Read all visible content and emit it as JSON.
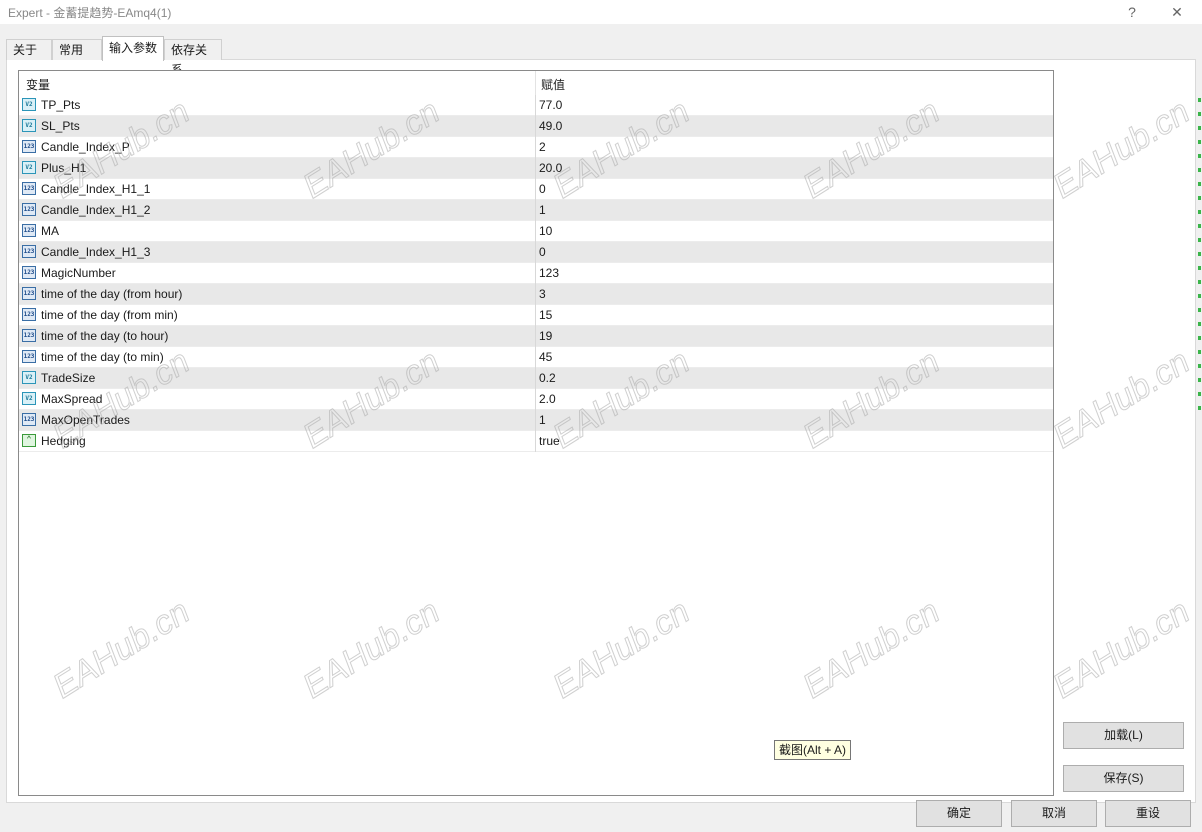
{
  "window": {
    "title": "Expert - 金蓄提趋势-EAmq4(1)",
    "help_label": "?",
    "close_label": "✕"
  },
  "tabs": [
    {
      "label": "关于",
      "active": false
    },
    {
      "label": "常用",
      "active": false
    },
    {
      "label": "输入参数",
      "active": true
    },
    {
      "label": "依存关系",
      "active": false
    }
  ],
  "table": {
    "header": {
      "variable": "变量",
      "value": "赋值"
    },
    "rows": [
      {
        "type": "double",
        "icon": "v2-icon",
        "name": "TP_Pts",
        "value": "77.0"
      },
      {
        "type": "double",
        "icon": "v2-icon",
        "name": "SL_Pts",
        "value": "49.0"
      },
      {
        "type": "int",
        "icon": "123-icon",
        "name": "Candle_Index_P",
        "value": "2"
      },
      {
        "type": "double",
        "icon": "v2-icon",
        "name": "Plus_H1",
        "value": "20.0"
      },
      {
        "type": "int",
        "icon": "123-icon",
        "name": "Candle_Index_H1_1",
        "value": "0"
      },
      {
        "type": "int",
        "icon": "123-icon",
        "name": "Candle_Index_H1_2",
        "value": "1"
      },
      {
        "type": "int",
        "icon": "123-icon",
        "name": "MA",
        "value": "10"
      },
      {
        "type": "int",
        "icon": "123-icon",
        "name": "Candle_Index_H1_3",
        "value": "0"
      },
      {
        "type": "int",
        "icon": "123-icon",
        "name": "MagicNumber",
        "value": "123"
      },
      {
        "type": "int",
        "icon": "123-icon",
        "name": "time of the day (from hour)",
        "value": "3"
      },
      {
        "type": "int",
        "icon": "123-icon",
        "name": "time of the day (from min)",
        "value": "15"
      },
      {
        "type": "int",
        "icon": "123-icon",
        "name": "time of the day (to hour)",
        "value": "19"
      },
      {
        "type": "int",
        "icon": "123-icon",
        "name": "time of the day (to min)",
        "value": "45"
      },
      {
        "type": "double",
        "icon": "v2-icon",
        "name": "TradeSize",
        "value": "0.2"
      },
      {
        "type": "double",
        "icon": "v2-icon",
        "name": "MaxSpread",
        "value": "2.0"
      },
      {
        "type": "int",
        "icon": "123-icon",
        "name": "MaxOpenTrades",
        "value": "1"
      },
      {
        "type": "bool",
        "icon": "bool-chart-icon",
        "name": "Hedging",
        "value": "true"
      }
    ]
  },
  "side_buttons": {
    "load_label": "加载(L)",
    "save_label": "保存(S)"
  },
  "bottom_buttons": {
    "ok_label": "确定",
    "cancel_label": "取消",
    "reset_label": "重设"
  },
  "tooltip": {
    "text": "截图(Alt + A)"
  },
  "watermark": {
    "text": "EAHub.cn"
  }
}
